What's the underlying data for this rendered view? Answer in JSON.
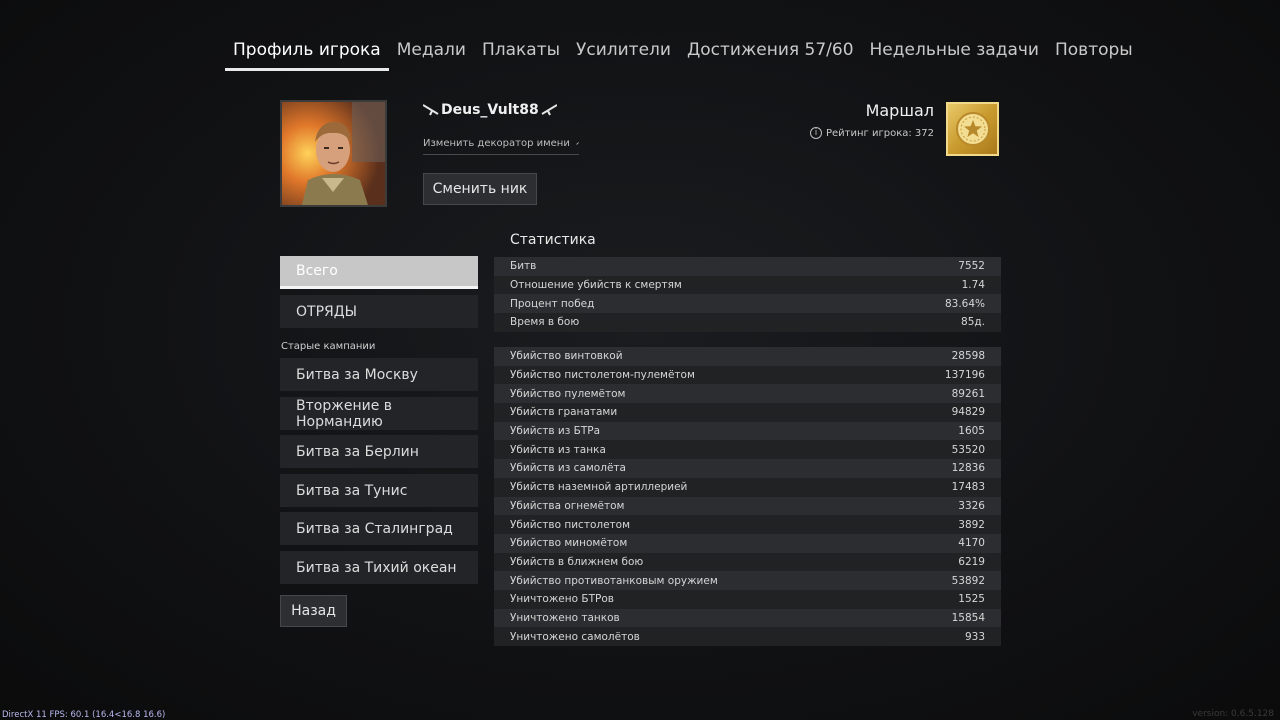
{
  "tabs": [
    {
      "label": "Профиль игрока",
      "active": true
    },
    {
      "label": "Медали"
    },
    {
      "label": "Плакаты"
    },
    {
      "label": "Усилители"
    },
    {
      "label": "Достижения 57/60"
    },
    {
      "label": "Недельные задачи"
    },
    {
      "label": "Повторы"
    }
  ],
  "profile": {
    "nickname": "Deus_Vult88",
    "decorator_label": "Изменить декоратор имени",
    "change_nick_label": "Сменить ник",
    "rank_name": "Маршал",
    "rating_text": "Рейтинг игрока: 372"
  },
  "sidebar": {
    "top_items": [
      {
        "label": "Всего",
        "active": true
      },
      {
        "label": "ОТРЯДЫ"
      }
    ],
    "old_campaigns_label": "Старые кампании",
    "campaigns": [
      {
        "label": "Битва за Москву"
      },
      {
        "label": "Вторжение в Нормандию"
      },
      {
        "label": "Битва за Берлин"
      },
      {
        "label": "Битва за Тунис"
      },
      {
        "label": "Битва за Сталинград"
      },
      {
        "label": "Битва за Тихий океан"
      }
    ],
    "back_label": "Назад"
  },
  "stats": {
    "title": "Статистика",
    "summary": [
      {
        "label": "Битв",
        "value": "7552"
      },
      {
        "label": "Отношение убийств к смертям",
        "value": "1.74"
      },
      {
        "label": "Процент побед",
        "value": "83.64%"
      },
      {
        "label": "Время в бою",
        "value": "85д."
      }
    ],
    "details": [
      {
        "label": "Убийство винтовкой",
        "value": "28598"
      },
      {
        "label": "Убийство пистолетом-пулемётом",
        "value": "137196"
      },
      {
        "label": "Убийство пулемётом",
        "value": "89261"
      },
      {
        "label": "Убийств гранатами",
        "value": "94829"
      },
      {
        "label": "Убийств из БТРа",
        "value": "1605"
      },
      {
        "label": "Убийств из танка",
        "value": "53520"
      },
      {
        "label": "Убийств из самолёта",
        "value": "12836"
      },
      {
        "label": "Убийств наземной артиллерией",
        "value": "17483"
      },
      {
        "label": "Убийства огнемётом",
        "value": "3326"
      },
      {
        "label": "Убийство пистолетом",
        "value": "3892"
      },
      {
        "label": "Убийство миномётом",
        "value": "4170"
      },
      {
        "label": "Убийств в ближнем бою",
        "value": "6219"
      },
      {
        "label": "Убийство противотанковым оружием",
        "value": "53892"
      },
      {
        "label": "Уничтожено БТРов",
        "value": "1525"
      },
      {
        "label": "Уничтожено танков",
        "value": "15854"
      },
      {
        "label": "Уничтожено самолётов",
        "value": "933"
      }
    ]
  },
  "footer": {
    "fps_text": "DirectX 11 FPS: 60.1 (16.4<16.8 16.6)",
    "version_text": "version: 0.6.5.128"
  },
  "colors": {
    "background": "#111214",
    "row_odd": "#2b2d30",
    "row_even": "#202224",
    "rank_gold": "#d9b24a",
    "fps_text": "#b9b9ee"
  },
  "icons": {
    "nickname_decor": "crossed-rifles-icon",
    "decorator_edit": "pencil-icon",
    "rating_info": "info-icon",
    "rank": "marshal-star-icon"
  }
}
